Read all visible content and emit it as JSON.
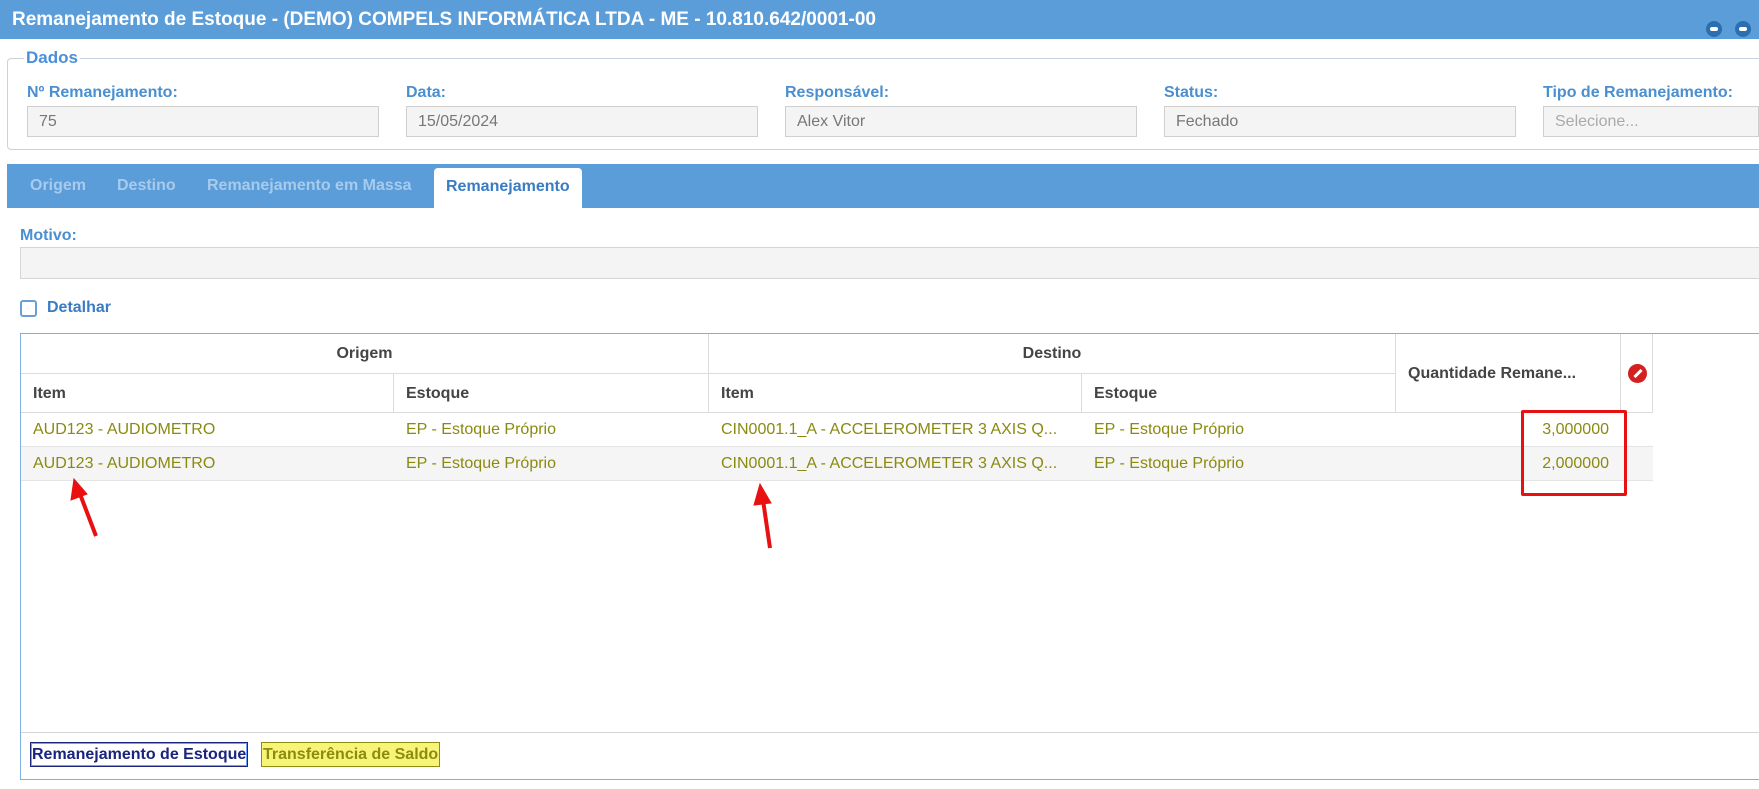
{
  "window": {
    "title": "Remanejamento de Estoque - (DEMO) COMPELS INFORMÁTICA LTDA - ME - 10.810.642/0001-00"
  },
  "dados": {
    "legend": "Dados",
    "fields": [
      {
        "label": "Nº Remanejamento:",
        "value": "75"
      },
      {
        "label": "Data:",
        "value": "15/05/2024"
      },
      {
        "label": "Responsável:",
        "value": "Alex Vitor"
      },
      {
        "label": "Status:",
        "value": "Fechado"
      },
      {
        "label": "Tipo de Remanejamento:",
        "placeholder": "Selecione..."
      }
    ]
  },
  "tabs": [
    {
      "label": "Origem",
      "active": false
    },
    {
      "label": "Destino",
      "active": false
    },
    {
      "label": "Remanejamento em Massa",
      "active": false
    },
    {
      "label": "Remanejamento",
      "active": true
    }
  ],
  "motivo": {
    "label": "Motivo:",
    "value": ""
  },
  "detalhar": {
    "label": "Detalhar",
    "checked": false
  },
  "grid": {
    "group_headers": {
      "origem": "Origem",
      "destino": "Destino"
    },
    "columns": {
      "origem_item": "Item",
      "origem_estoque": "Estoque",
      "destino_item": "Item",
      "destino_estoque": "Estoque",
      "quantidade": "Quantidade Remane..."
    },
    "rows": [
      {
        "origem_item": "AUD123 - AUDIOMETRO",
        "origem_estoque": "EP - Estoque Próprio",
        "destino_item": "CIN0001.1_A - ACCELEROMETER 3 AXIS Q...",
        "destino_estoque": "EP - Estoque Próprio",
        "quantidade": "3,000000"
      },
      {
        "origem_item": "AUD123 - AUDIOMETRO",
        "origem_estoque": "EP - Estoque Próprio",
        "destino_item": "CIN0001.1_A - ACCELEROMETER 3 AXIS Q...",
        "destino_estoque": "EP - Estoque Próprio",
        "quantidade": "2,000000"
      }
    ]
  },
  "legend": {
    "blue": "Remanejamento de Estoque",
    "yellow": "Transferência de Saldo"
  },
  "colors": {
    "header_blue": "#5b9dd9",
    "label_blue": "#4a8fd0",
    "row_text_olive": "#8a8a10",
    "annotation_red": "#e81010"
  }
}
